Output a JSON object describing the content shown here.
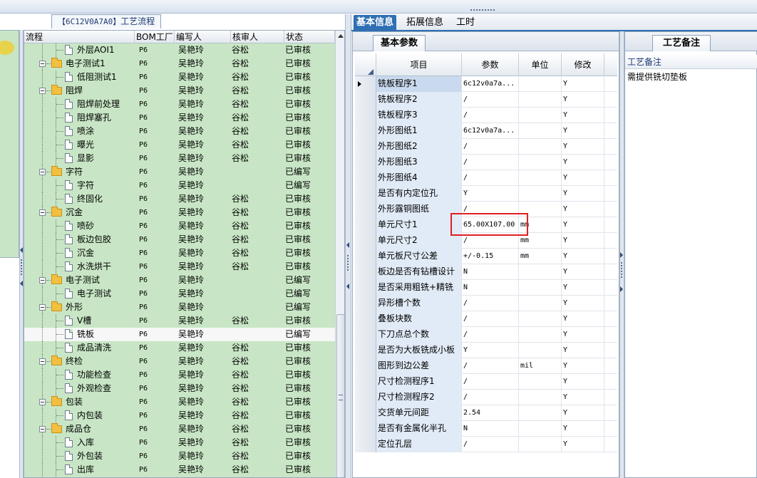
{
  "tree_header": {
    "code": "【6C12V0A7A0】",
    "title": "工艺流程"
  },
  "tree_columns": [
    "流程",
    "BOM工厂",
    "编写人",
    "核审人",
    "状态"
  ],
  "tree_rows": [
    {
      "label": "外层AOI1",
      "level": 1,
      "type": "doc",
      "factory": "P6",
      "author": "吴艳玲",
      "reviewer": "谷松",
      "status": "已审核"
    },
    {
      "label": "电子测试1",
      "level": 0,
      "type": "folder",
      "factory": "P6",
      "author": "吴艳玲",
      "reviewer": "谷松",
      "status": "已审核"
    },
    {
      "label": "低阻测试1",
      "level": 1,
      "type": "doc",
      "factory": "P6",
      "author": "吴艳玲",
      "reviewer": "谷松",
      "status": "已审核"
    },
    {
      "label": "阻焊",
      "level": 0,
      "type": "folder",
      "factory": "P6",
      "author": "吴艳玲",
      "reviewer": "谷松",
      "status": "已审核"
    },
    {
      "label": "阻焊前处理",
      "level": 1,
      "type": "doc",
      "factory": "P6",
      "author": "吴艳玲",
      "reviewer": "谷松",
      "status": "已审核"
    },
    {
      "label": "阻焊塞孔",
      "level": 1,
      "type": "doc",
      "factory": "P6",
      "author": "吴艳玲",
      "reviewer": "谷松",
      "status": "已审核"
    },
    {
      "label": "喷涂",
      "level": 1,
      "type": "doc",
      "factory": "P6",
      "author": "吴艳玲",
      "reviewer": "谷松",
      "status": "已审核"
    },
    {
      "label": "曝光",
      "level": 1,
      "type": "doc",
      "factory": "P6",
      "author": "吴艳玲",
      "reviewer": "谷松",
      "status": "已审核"
    },
    {
      "label": "显影",
      "level": 1,
      "type": "doc",
      "factory": "P6",
      "author": "吴艳玲",
      "reviewer": "谷松",
      "status": "已审核"
    },
    {
      "label": "字符",
      "level": 0,
      "type": "folder",
      "factory": "P6",
      "author": "吴艳玲",
      "reviewer": "",
      "status": "已编写"
    },
    {
      "label": "字符",
      "level": 1,
      "type": "doc",
      "factory": "P6",
      "author": "吴艳玲",
      "reviewer": "",
      "status": "已编写"
    },
    {
      "label": "终固化",
      "level": 1,
      "type": "doc",
      "factory": "P6",
      "author": "吴艳玲",
      "reviewer": "谷松",
      "status": "已审核"
    },
    {
      "label": "沉金",
      "level": 0,
      "type": "folder",
      "factory": "P6",
      "author": "吴艳玲",
      "reviewer": "谷松",
      "status": "已审核"
    },
    {
      "label": "喷砂",
      "level": 1,
      "type": "doc",
      "factory": "P6",
      "author": "吴艳玲",
      "reviewer": "谷松",
      "status": "已审核"
    },
    {
      "label": "板边包胶",
      "level": 1,
      "type": "doc",
      "factory": "P6",
      "author": "吴艳玲",
      "reviewer": "谷松",
      "status": "已审核"
    },
    {
      "label": "沉金",
      "level": 1,
      "type": "doc",
      "factory": "P6",
      "author": "吴艳玲",
      "reviewer": "谷松",
      "status": "已审核"
    },
    {
      "label": "水洗烘干",
      "level": 1,
      "type": "doc",
      "factory": "P6",
      "author": "吴艳玲",
      "reviewer": "谷松",
      "status": "已审核"
    },
    {
      "label": "电子测试",
      "level": 0,
      "type": "folder",
      "factory": "P6",
      "author": "吴艳玲",
      "reviewer": "",
      "status": "已编写"
    },
    {
      "label": "电子测试",
      "level": 1,
      "type": "doc",
      "factory": "P6",
      "author": "吴艳玲",
      "reviewer": "",
      "status": "已编写"
    },
    {
      "label": "外形",
      "level": 0,
      "type": "folder",
      "factory": "P6",
      "author": "吴艳玲",
      "reviewer": "",
      "status": "已编写"
    },
    {
      "label": "V槽",
      "level": 1,
      "type": "doc",
      "factory": "P6",
      "author": "吴艳玲",
      "reviewer": "谷松",
      "status": "已审核"
    },
    {
      "label": "铣板",
      "level": 1,
      "type": "doc",
      "factory": "P6",
      "author": "吴艳玲",
      "reviewer": "",
      "status": "已编写",
      "selected": true
    },
    {
      "label": "成品清洗",
      "level": 1,
      "type": "doc",
      "factory": "P6",
      "author": "吴艳玲",
      "reviewer": "谷松",
      "status": "已审核"
    },
    {
      "label": "终检",
      "level": 0,
      "type": "folder",
      "factory": "P6",
      "author": "吴艳玲",
      "reviewer": "谷松",
      "status": "已审核"
    },
    {
      "label": "功能检查",
      "level": 1,
      "type": "doc",
      "factory": "P6",
      "author": "吴艳玲",
      "reviewer": "谷松",
      "status": "已审核"
    },
    {
      "label": "外观检查",
      "level": 1,
      "type": "doc",
      "factory": "P6",
      "author": "吴艳玲",
      "reviewer": "谷松",
      "status": "已审核"
    },
    {
      "label": "包装",
      "level": 0,
      "type": "folder",
      "factory": "P6",
      "author": "吴艳玲",
      "reviewer": "谷松",
      "status": "已审核"
    },
    {
      "label": "内包装",
      "level": 1,
      "type": "doc",
      "factory": "P6",
      "author": "吴艳玲",
      "reviewer": "谷松",
      "status": "已审核"
    },
    {
      "label": "成品仓",
      "level": 0,
      "type": "folder",
      "factory": "P6",
      "author": "吴艳玲",
      "reviewer": "谷松",
      "status": "已审核"
    },
    {
      "label": "入库",
      "level": 1,
      "type": "doc",
      "factory": "P6",
      "author": "吴艳玲",
      "reviewer": "谷松",
      "status": "已审核"
    },
    {
      "label": "外包装",
      "level": 1,
      "type": "doc",
      "factory": "P6",
      "author": "吴艳玲",
      "reviewer": "谷松",
      "status": "已审核"
    },
    {
      "label": "出库",
      "level": 1,
      "type": "doc",
      "factory": "P6",
      "author": "吴艳玲",
      "reviewer": "谷松",
      "status": "已审核"
    }
  ],
  "tabs": [
    {
      "label": "基本信息",
      "active": true
    },
    {
      "label": "拓展信息",
      "active": false
    },
    {
      "label": "工时",
      "active": false
    }
  ],
  "params_panel": {
    "title": "基本参数",
    "columns": [
      "项目",
      "参数",
      "单位",
      "修改"
    ],
    "rows": [
      {
        "item": "铣板程序1",
        "param": "6c12v0a7a...",
        "unit": "",
        "edit": "Y",
        "current": true
      },
      {
        "item": "铣板程序2",
        "param": "/",
        "unit": "",
        "edit": "Y"
      },
      {
        "item": "铣板程序3",
        "param": "/",
        "unit": "",
        "edit": "Y"
      },
      {
        "item": "外形图纸1",
        "param": "6c12v0a7a...",
        "unit": "",
        "edit": "Y"
      },
      {
        "item": "外形图纸2",
        "param": "/",
        "unit": "",
        "edit": "Y"
      },
      {
        "item": "外形图纸3",
        "param": "/",
        "unit": "",
        "edit": "Y"
      },
      {
        "item": "外形图纸4",
        "param": "/",
        "unit": "",
        "edit": "Y"
      },
      {
        "item": "是否有内定位孔",
        "param": "Y",
        "unit": "",
        "edit": "Y"
      },
      {
        "item": "外形露铜图纸",
        "param": "/",
        "unit": "",
        "edit": "Y"
      },
      {
        "item": "单元尺寸1",
        "param": "65.00X107.00",
        "unit": "mm",
        "edit": "Y"
      },
      {
        "item": "单元尺寸2",
        "param": "/",
        "unit": "mm",
        "edit": "Y"
      },
      {
        "item": "单元板尺寸公差",
        "param": "+/-0.15",
        "unit": "mm",
        "edit": "Y"
      },
      {
        "item": "板边是否有钻槽设计",
        "param": "N",
        "unit": "",
        "edit": "Y"
      },
      {
        "item": "是否采用粗铣+精铣",
        "param": "N",
        "unit": "",
        "edit": "Y"
      },
      {
        "item": "异形槽个数",
        "param": "/",
        "unit": "",
        "edit": "Y"
      },
      {
        "item": "叠板块数",
        "param": "/",
        "unit": "",
        "edit": "Y"
      },
      {
        "item": "下刀点总个数",
        "param": "/",
        "unit": "",
        "edit": "Y"
      },
      {
        "item": "是否为大板铣成小板",
        "param": "Y",
        "unit": "",
        "edit": "Y"
      },
      {
        "item": "图形到边公差",
        "param": "/",
        "unit": "mil",
        "edit": "Y"
      },
      {
        "item": "尺寸检测程序1",
        "param": "/",
        "unit": "",
        "edit": "Y"
      },
      {
        "item": "尺寸检测程序2",
        "param": "/",
        "unit": "",
        "edit": "Y"
      },
      {
        "item": "交货单元间距",
        "param": "2.54",
        "unit": "",
        "edit": "Y"
      },
      {
        "item": "是否有金属化半孔",
        "param": "N",
        "unit": "",
        "edit": "Y"
      },
      {
        "item": "定位孔层",
        "param": "/",
        "unit": "",
        "edit": "Y"
      }
    ]
  },
  "notes_panel": {
    "title": "工艺备注",
    "header": "工艺备注",
    "text": "需提供铣切垫板"
  },
  "colors": {
    "tree_bg": "#c8e6c5",
    "tab_active": "#2f6fb3",
    "highlight_box": "#e02020"
  }
}
